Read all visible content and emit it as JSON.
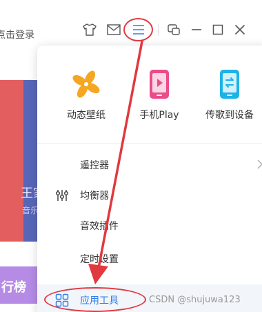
{
  "header": {
    "login_text": "点击登录",
    "icons": [
      "tshirt-icon",
      "mail-icon",
      "menu-icon",
      "mini-mode-icon",
      "minimize-icon",
      "maximize-icon",
      "close-icon"
    ]
  },
  "background": {
    "card_text": "王家",
    "card_sub": "音乐",
    "strip_text": "行榜"
  },
  "menu": {
    "top_items": [
      {
        "label": "动态壁纸",
        "icon": "pinwheel-icon"
      },
      {
        "label": "手机Play",
        "icon": "phone-play-icon"
      },
      {
        "label": "传歌到设备",
        "icon": "phone-transfer-icon"
      }
    ],
    "items": [
      {
        "label": "遥控器",
        "icon": "",
        "has_submenu": true
      },
      {
        "label": "均衡器",
        "icon": "equalizer-icon",
        "has_submenu": false
      },
      {
        "label": "音效插件",
        "icon": "",
        "has_submenu": false
      },
      {
        "label": "定时设置",
        "icon": "",
        "has_submenu": false
      },
      {
        "label": "应用工具",
        "icon": "grid-icon",
        "has_submenu": false
      }
    ]
  },
  "watermark": "CSDN @shujuwa123",
  "colors": {
    "accent": "#2f7ee8",
    "annotation": "#e0393e",
    "pinwheel": "#f5a623",
    "phone_play": "#ea4c89",
    "phone_transfer": "#1eb3e6"
  }
}
